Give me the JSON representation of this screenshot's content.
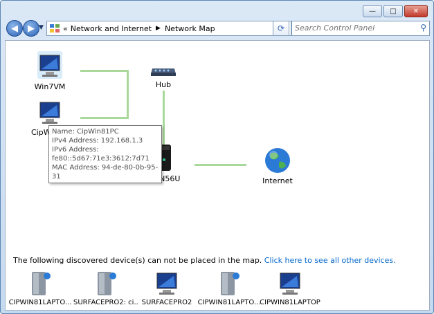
{
  "window": {
    "caption_buttons": [
      "minimize",
      "maximize",
      "close"
    ]
  },
  "address_bar": {
    "crumbs": [
      "Network and Internet",
      "Network Map"
    ],
    "search_placeholder": "Search Control Panel"
  },
  "map": {
    "nodes": {
      "win7vm": "Win7VM",
      "cipwin": "CipWi",
      "hub": "Hub",
      "router": "RT-N56U",
      "internet": "Internet"
    },
    "tooltip": {
      "name": "Name: CipWin81PC",
      "ipv4": "IPv4 Address: 192.168.1.3",
      "ipv6_label": "IPv6 Address:",
      "ipv6_value": "fe80::5d67:71e3:3612:7d71",
      "mac": "MAC Address: 94-de-80-0b-95-31"
    }
  },
  "undiscovered": {
    "message": "The following discovered device(s) can not be placed in the map.",
    "link": "Click here to see all other devices.",
    "devices": [
      "CIPWIN81LAPTO...",
      "SURFACEPRO2: ci...",
      "SURFACEPRO2",
      "CIPWIN81LAPTO...",
      "CIPWIN81LAPTOP"
    ]
  },
  "colors": {
    "link_line": "#a8d99a",
    "hyperlink": "#0066cc",
    "accent": "#2d62b4"
  },
  "icons": [
    "back-icon",
    "forward-icon",
    "control-panel-icon",
    "refresh-icon",
    "search-icon",
    "computer-icon",
    "hub-icon",
    "router-icon",
    "globe-icon",
    "media-device-icon"
  ]
}
